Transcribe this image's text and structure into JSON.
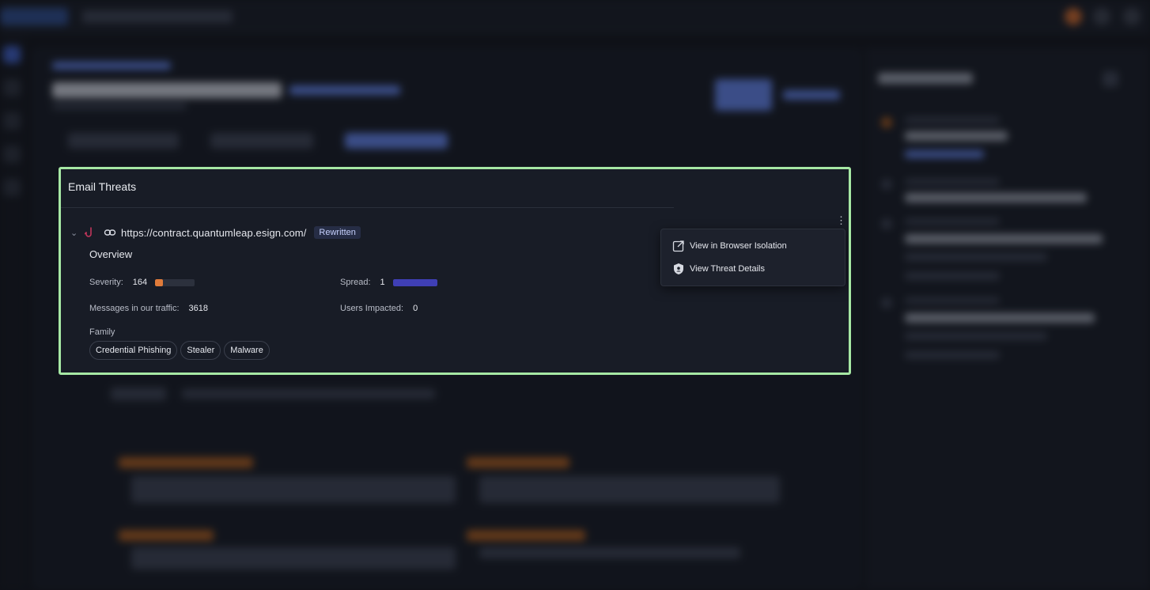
{
  "card": {
    "title": "Email Threats",
    "url": "https://contract.quantumleap.esign.com/",
    "badge": "Rewritten",
    "overview_label": "Overview",
    "severity": {
      "label": "Severity:",
      "value": "164",
      "level_fraction": 0.2,
      "color": "#e07b3a"
    },
    "spread": {
      "label": "Spread:",
      "value": "1",
      "level_fraction": 1.0,
      "color": "#3f3fb5"
    },
    "messages": {
      "label": "Messages in our traffic:",
      "value": "3618"
    },
    "users": {
      "label": "Users Impacted:",
      "value": "0"
    },
    "family_label": "Family",
    "family": [
      "Credential Phishing",
      "Stealer",
      "Malware"
    ],
    "actions_icon": "kebab-menu-icon"
  },
  "menu": {
    "items": [
      {
        "label": "View in Browser Isolation",
        "icon": "external-link-icon"
      },
      {
        "label": "View Threat Details",
        "icon": "shield-icon"
      }
    ]
  },
  "colors": {
    "highlight_border": "#a6e8a4",
    "card_background": "#181c26",
    "page_background": "#0f1117",
    "hook_icon": "#c0355a"
  }
}
